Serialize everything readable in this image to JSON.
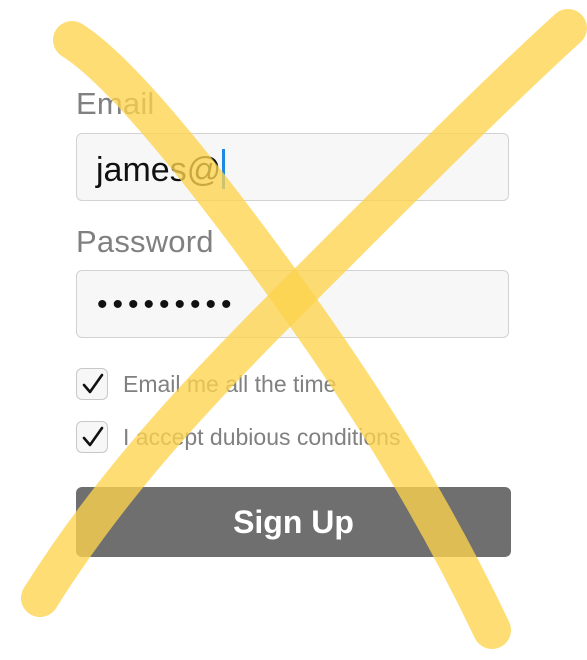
{
  "form": {
    "email_label": "Email",
    "email_value": "james@",
    "password_label": "Password",
    "password_masked": "•••••••••",
    "checkbox_1": {
      "label": "Email me all the time",
      "checked": true
    },
    "checkbox_2": {
      "label": "I accept dubious conditions",
      "checked": true
    },
    "signup_label": "Sign Up"
  },
  "colors": {
    "label_gray": "#808080",
    "button_gray": "#6f6f6f",
    "caret_blue": "#1e88e5",
    "cross_yellow": "#fcd34d"
  },
  "icons": [
    "checkmark-icon",
    "text-caret",
    "x-cross-overlay"
  ]
}
